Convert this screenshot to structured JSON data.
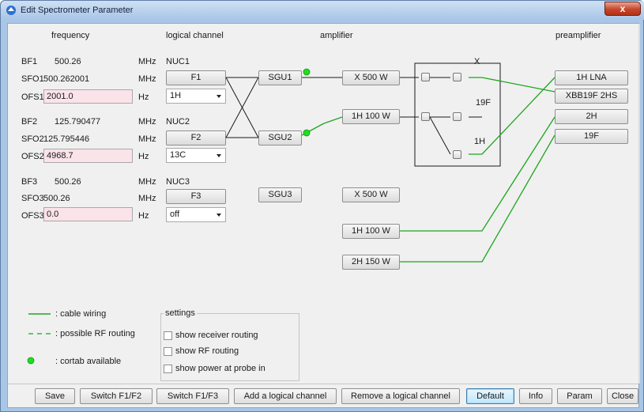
{
  "window": {
    "title": "Edit Spectrometer Parameter",
    "close_label": "x"
  },
  "headers": {
    "frequency": "frequency",
    "logical_channel": "logical channel",
    "amplifier": "amplifier",
    "preamplifier": "preamplifier"
  },
  "channels": [
    {
      "bf_label": "BF1",
      "bf_value": "500.26",
      "bf_unit": "MHz",
      "nuc": "NUC1",
      "sfo_label": "SFO1",
      "sfo_value": "500.262001",
      "sfo_unit": "MHz",
      "f_button": "F1",
      "ofs_label": "OFS1",
      "ofs_value": "2001.0",
      "ofs_unit": "Hz",
      "nucleus": "1H"
    },
    {
      "bf_label": "BF2",
      "bf_value": "125.790477",
      "bf_unit": "MHz",
      "nuc": "NUC2",
      "sfo_label": "SFO2",
      "sfo_value": "125.795446",
      "sfo_unit": "MHz",
      "f_button": "F2",
      "ofs_label": "OFS2",
      "ofs_value": "4968.7",
      "ofs_unit": "Hz",
      "nucleus": "13C"
    },
    {
      "bf_label": "BF3",
      "bf_value": "500.26",
      "bf_unit": "MHz",
      "nuc": "NUC3",
      "sfo_label": "SFO3",
      "sfo_value": "500.26",
      "sfo_unit": "MHz",
      "f_button": "F3",
      "ofs_label": "OFS3",
      "ofs_value": "0.0",
      "ofs_unit": "Hz",
      "nucleus": "off"
    }
  ],
  "sgu": [
    "SGU1",
    "SGU2",
    "SGU3"
  ],
  "amplifiers": [
    "X 500 W",
    "1H 100 W",
    "X 500 W",
    "1H 100 W",
    "2H 150 W"
  ],
  "router_labels": {
    "x": "X",
    "f19": "19F",
    "h1": "1H"
  },
  "preamplifiers": [
    "1H LNA",
    "XBB19F 2HS",
    "2H",
    "19F"
  ],
  "legend": {
    "cable": ": cable wiring",
    "rf": ": possible RF routing",
    "cortab": ": cortab available"
  },
  "settings": {
    "title": "settings",
    "options": [
      "show receiver routing",
      "show RF routing",
      "show power at probe in"
    ]
  },
  "buttons": [
    "Save",
    "Switch F1/F2",
    "Switch F1/F3",
    "Add a logical channel",
    "Remove a logical channel",
    "Default",
    "Info",
    "Param",
    "Close"
  ],
  "colors": {
    "wire_green": "#1fa51f",
    "cortab_green": "#22dd22",
    "ofs_field_bg": "#fbe3ea"
  }
}
